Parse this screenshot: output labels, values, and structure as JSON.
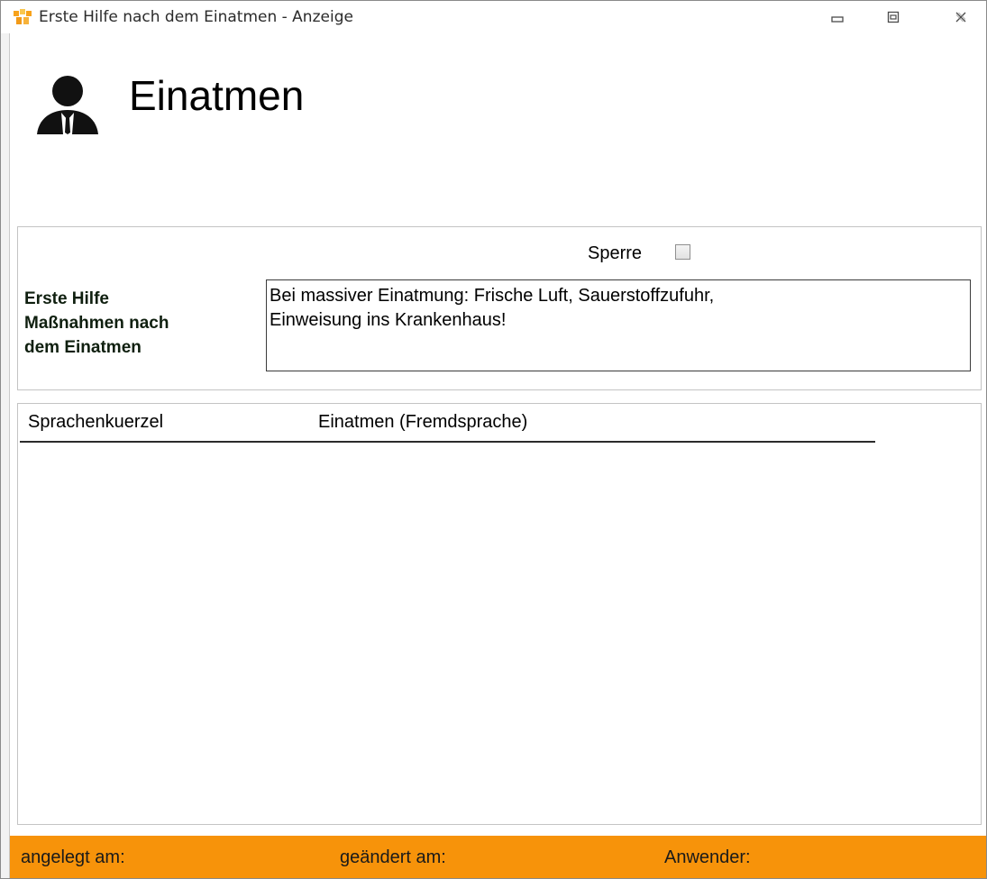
{
  "window": {
    "title": "Erste Hilfe nach dem Einatmen - Anzeige",
    "controls": [
      "minimize-icon",
      "maximize-icon",
      "close-icon"
    ]
  },
  "header": {
    "title": "Einatmen",
    "icon": "person-icon"
  },
  "detail": {
    "sperre_label": "Sperre",
    "sperre_checked": false,
    "field_label_lines": [
      "Erste Hilfe",
      "Maßnahmen nach",
      "dem Einatmen"
    ],
    "field_value_lines": [
      "Bei massiver Einatmung: Frische Luft, Sauerstoffzufuhr,",
      "Einweisung ins Krankenhaus!"
    ]
  },
  "list": {
    "columns": [
      "Sprachenkuerzel",
      "Einatmen (Fremdsprache)"
    ],
    "rows": []
  },
  "status": {
    "created_label": "angelegt am:",
    "changed_label": "geändert am:",
    "user_label": "Anwender:"
  },
  "colors": {
    "statusbar": "#f7930a",
    "app_icon_orange": "#f7a21b"
  }
}
